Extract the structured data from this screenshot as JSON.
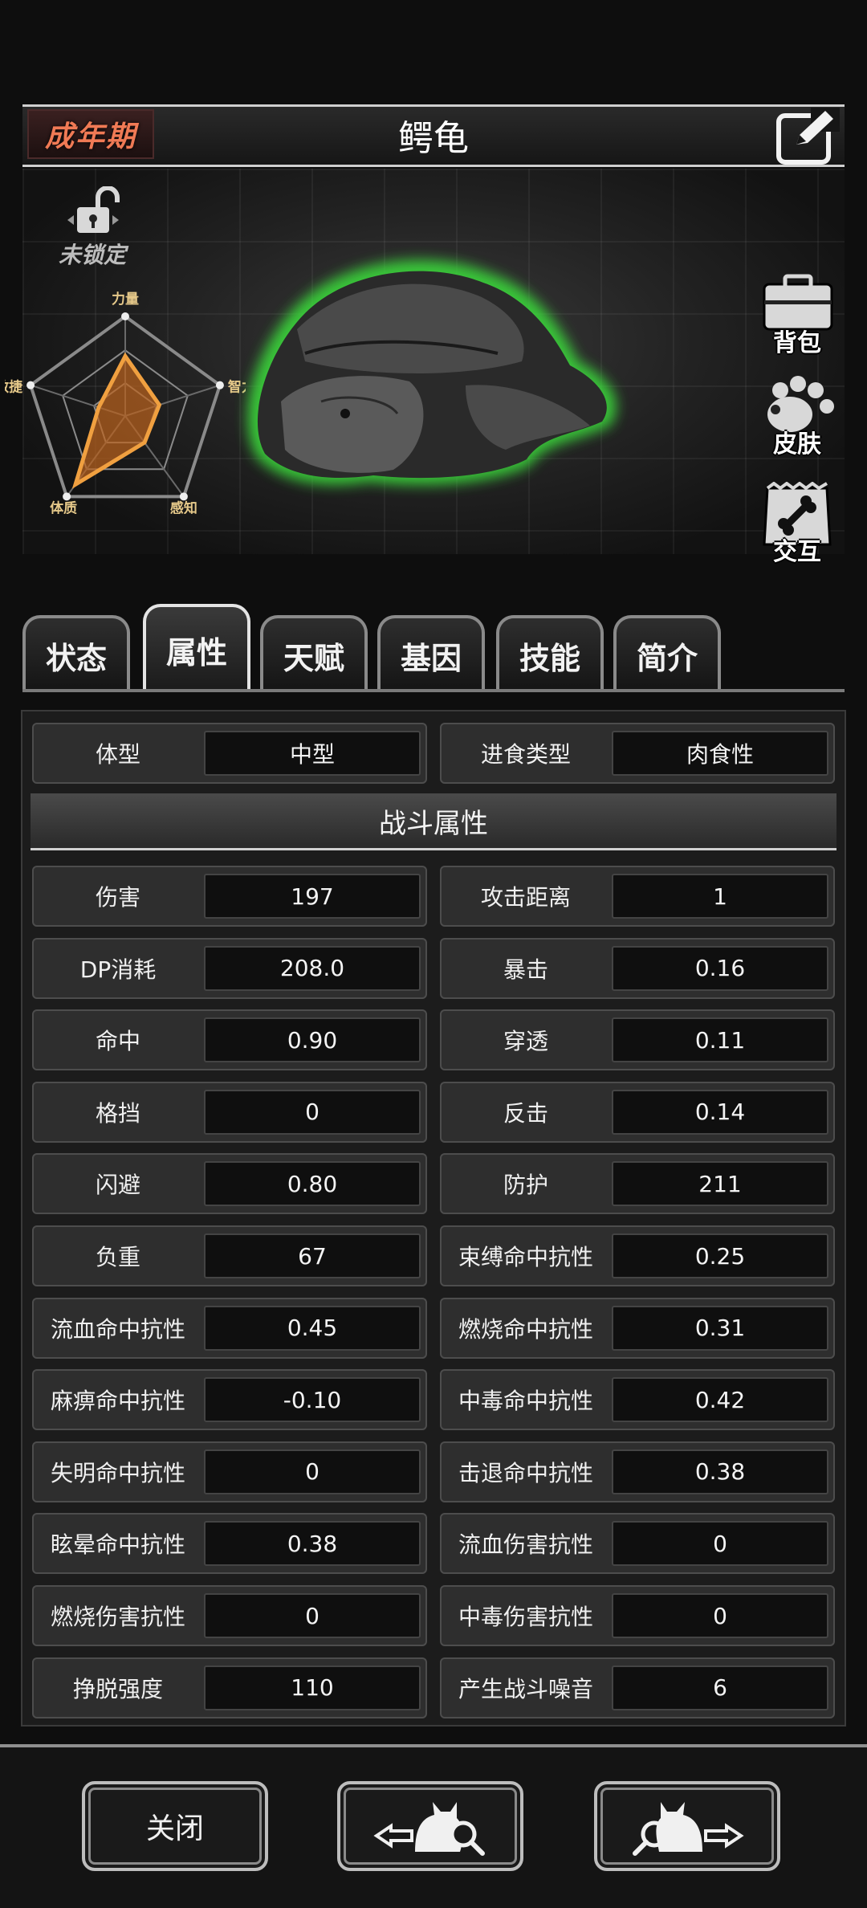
{
  "header": {
    "stage": "成年期",
    "title": "鳄龟"
  },
  "lock": {
    "label": "未锁定"
  },
  "radar": {
    "labels": [
      "力量",
      "智力",
      "感知",
      "体质",
      "敏捷"
    ],
    "values": [
      0.6,
      0.36,
      0.33,
      0.85,
      0.28
    ]
  },
  "side_buttons": [
    "背包",
    "皮肤",
    "交互"
  ],
  "tabs": [
    "状态",
    "属性",
    "天赋",
    "基因",
    "技能",
    "简介"
  ],
  "active_tab": "属性",
  "basic": [
    {
      "label": "体型",
      "value": "中型"
    },
    {
      "label": "进食类型",
      "value": "肉食性"
    }
  ],
  "section_title": "战斗属性",
  "stats": [
    {
      "label": "伤害",
      "value": "197"
    },
    {
      "label": "攻击距离",
      "value": "1"
    },
    {
      "label": "DP消耗",
      "value": "208.0"
    },
    {
      "label": "暴击",
      "value": "0.16"
    },
    {
      "label": "命中",
      "value": "0.90"
    },
    {
      "label": "穿透",
      "value": "0.11"
    },
    {
      "label": "格挡",
      "value": "0"
    },
    {
      "label": "反击",
      "value": "0.14"
    },
    {
      "label": "闪避",
      "value": "0.80"
    },
    {
      "label": "防护",
      "value": "211"
    },
    {
      "label": "负重",
      "value": "67"
    },
    {
      "label": "束缚命中抗性",
      "value": "0.25"
    },
    {
      "label": "流血命中抗性",
      "value": "0.45"
    },
    {
      "label": "燃烧命中抗性",
      "value": "0.31"
    },
    {
      "label": "麻痹命中抗性",
      "value": "-0.10"
    },
    {
      "label": "中毒命中抗性",
      "value": "0.42"
    },
    {
      "label": "失明命中抗性",
      "value": "0"
    },
    {
      "label": "击退命中抗性",
      "value": "0.38"
    },
    {
      "label": "眩晕命中抗性",
      "value": "0.38"
    },
    {
      "label": "流血伤害抗性",
      "value": "0"
    },
    {
      "label": "燃烧伤害抗性",
      "value": "0"
    },
    {
      "label": "中毒伤害抗性",
      "value": "0"
    },
    {
      "label": "挣脱强度",
      "value": "110"
    },
    {
      "label": "产生战斗噪音",
      "value": "6"
    }
  ],
  "bottom": {
    "close_label": "关闭"
  },
  "colors": {
    "accent_orange": "#f0a040",
    "stage_red": "#f07a55",
    "glow_green": "#3bd63b"
  }
}
